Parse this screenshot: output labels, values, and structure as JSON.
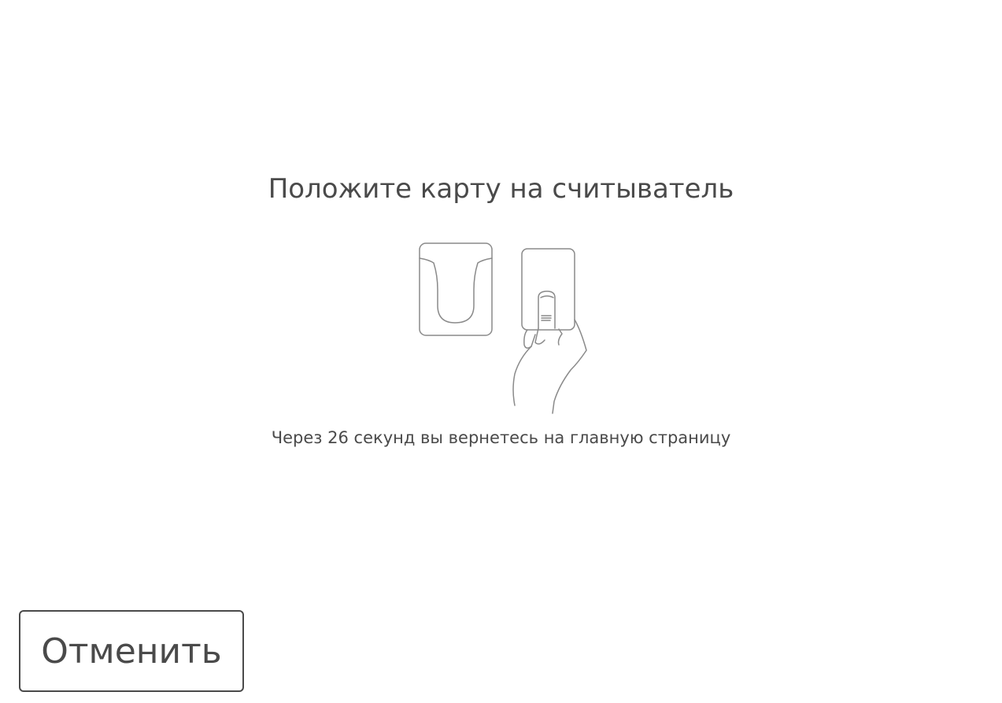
{
  "screen": {
    "title": "Положите карту на считыватель",
    "countdown_text": "Через 26 секунд вы вернетесь на главную страницу",
    "countdown_seconds": 26,
    "illustration": "card-reader-tap-icon"
  },
  "actions": {
    "cancel_label": "Отменить"
  },
  "colors": {
    "text": "#4a4a4a",
    "background": "#ffffff",
    "line_art": "#8a8a8a"
  }
}
